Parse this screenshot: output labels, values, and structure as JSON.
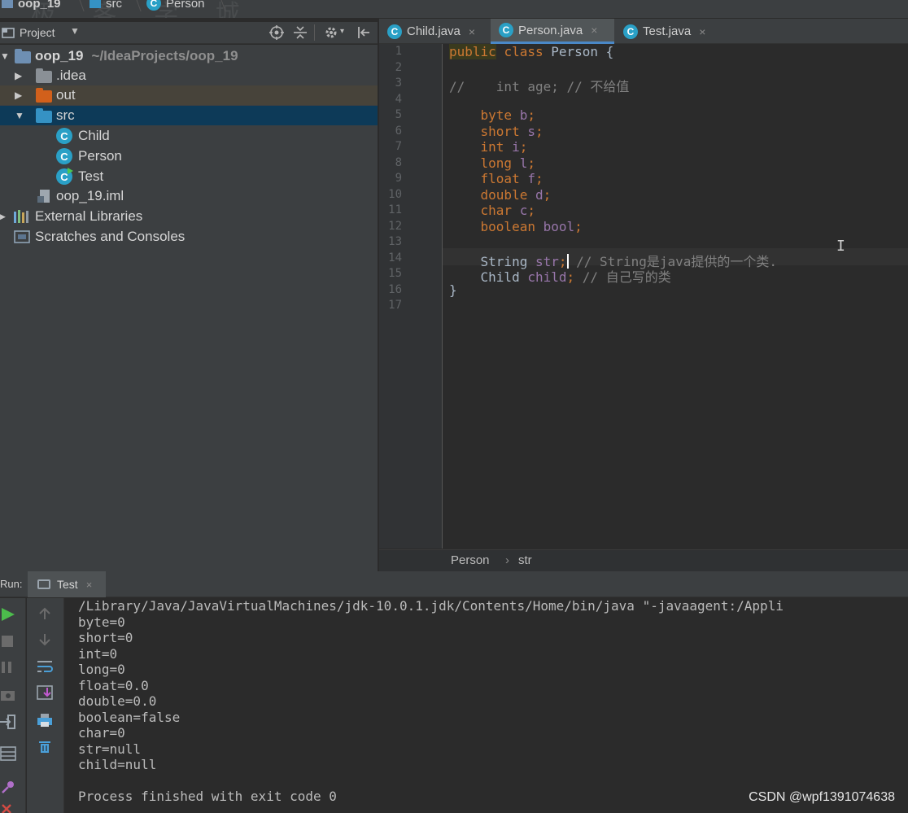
{
  "navbar": {
    "crumbs": [
      "oop_19",
      "src",
      "Person"
    ],
    "watermark": "极 客 学 城"
  },
  "project": {
    "header_title": "Project",
    "tree": [
      {
        "label": "oop_19",
        "path": "~/IdeaProjects/oop_19",
        "icon": "module-folder-icon"
      },
      {
        "label": ".idea",
        "icon": "folder-icon"
      },
      {
        "label": "out",
        "icon": "folder-orange-icon"
      },
      {
        "label": "src",
        "icon": "source-folder-icon",
        "selected": true
      },
      {
        "label": "Child",
        "icon": "class-icon"
      },
      {
        "label": "Person",
        "icon": "class-icon"
      },
      {
        "label": "Test",
        "icon": "runnable-class-icon"
      },
      {
        "label": "oop_19.iml",
        "icon": "iml-file-icon"
      },
      {
        "label": "External Libraries",
        "icon": "libraries-icon"
      },
      {
        "label": "Scratches and Consoles",
        "icon": "scratches-icon"
      }
    ]
  },
  "tabs": [
    {
      "label": "Child.java",
      "active": false
    },
    {
      "label": "Person.java",
      "active": true
    },
    {
      "label": "Test.java",
      "active": false
    }
  ],
  "editor": {
    "line_numbers": [
      "1",
      "2",
      "3",
      "4",
      "5",
      "6",
      "7",
      "8",
      "9",
      "10",
      "11",
      "12",
      "13",
      "14",
      "15",
      "16",
      "17"
    ],
    "l1_kw1": "public",
    "l1_kw2": "class",
    "l1_rest": " Person {",
    "l3_comment": "//    int age; // 不给值",
    "fields": [
      {
        "type": "byte",
        "name": "b"
      },
      {
        "type": "short",
        "name": "s"
      },
      {
        "type": "int",
        "name": "i"
      },
      {
        "type": "long",
        "name": "l"
      },
      {
        "type": "float",
        "name": "f"
      },
      {
        "type": "double",
        "name": "d"
      },
      {
        "type": "char",
        "name": "c"
      },
      {
        "type": "boolean",
        "name": "bool"
      }
    ],
    "l14_type": "String",
    "l14_name": "str",
    "l14_comment": " // String是java提供的一个类.",
    "l15_type": "Child",
    "l15_name": "child",
    "l15_comment": " // 自己写的类",
    "l16": "}"
  },
  "breadcrumb": {
    "class": "Person",
    "sep": "›",
    "member": "str"
  },
  "run": {
    "label": "Run:",
    "tab_label": "Test",
    "output": [
      "/Library/Java/JavaVirtualMachines/jdk-10.0.1.jdk/Contents/Home/bin/java \"-javaagent:/Appli",
      "byte=0",
      "short=0",
      "int=0",
      "long=0",
      "float=0.0",
      "double=0.0",
      "boolean=false",
      "char=0",
      "str=null",
      "child=null",
      "",
      "Process finished with exit code 0"
    ]
  },
  "credit": "CSDN @wpf1391074638",
  "colors": {
    "keyword": "#cc7832",
    "field": "#9876aa",
    "comment": "#808080",
    "class_icon": "#2aa0c6",
    "selection": "#0d3a58"
  }
}
